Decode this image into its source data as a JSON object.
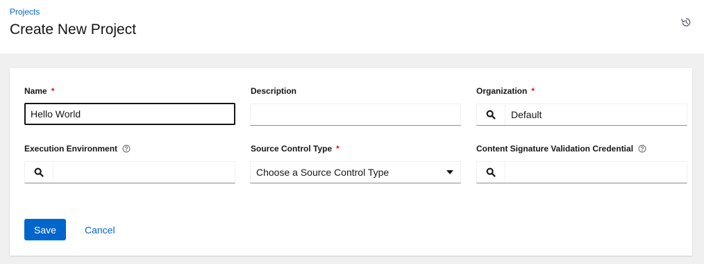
{
  "header": {
    "breadcrumb": "Projects",
    "title": "Create New Project",
    "history_icon": "history-icon"
  },
  "form": {
    "name": {
      "label": "Name",
      "required": "*",
      "value": "Hello World"
    },
    "description": {
      "label": "Description",
      "value": ""
    },
    "organization": {
      "label": "Organization",
      "required": "*",
      "value": "Default",
      "icon": "search-icon"
    },
    "execution_environment": {
      "label": "Execution Environment",
      "value": "",
      "icon": "search-icon",
      "help_icon": "question-circle-icon"
    },
    "source_control_type": {
      "label": "Source Control Type",
      "required": "*",
      "selected": "Choose a Source Control Type",
      "icon": "caret-down-icon"
    },
    "content_signature": {
      "label": "Content Signature Validation Credential",
      "value": "",
      "icon": "search-icon",
      "help_icon": "question-circle-icon"
    }
  },
  "actions": {
    "save_label": "Save",
    "cancel_label": "Cancel"
  },
  "colors": {
    "primary": "#0066cc",
    "required": "#c9190b",
    "background": "#f0f0f0"
  }
}
